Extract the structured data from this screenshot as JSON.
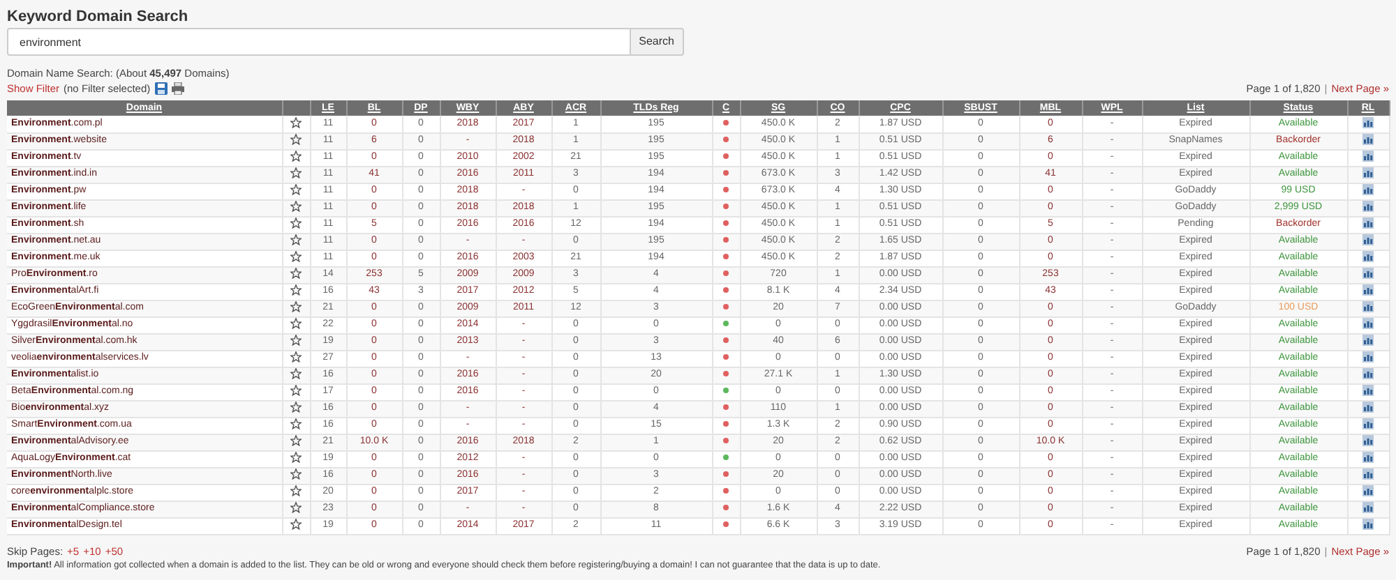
{
  "title": "Keyword Domain Search",
  "search": {
    "value": "environment",
    "button": "Search"
  },
  "summary": "Domain Name Search: (About **45,497** Domains)",
  "filter": {
    "link": "Show Filter",
    "note": "(no Filter selected)"
  },
  "pager_top": {
    "text": "Page 1 of 1,820",
    "separator": "|",
    "link": "Next Page »"
  },
  "table": {
    "columns": [
      "Domain",
      "LE",
      "BL",
      "DP",
      "WBY",
      "ABY",
      "ACR",
      "TLDs Reg",
      "C",
      "SG",
      "CO",
      "CPC",
      "SBUST",
      "MBL",
      "WPL",
      "List",
      "Status",
      "RL"
    ],
    "rows": [
      {
        "domain": "**Environment**.com.pl",
        "le": "11",
        "bl": "0",
        "dp": "0",
        "wby": "2018",
        "aby": "2017",
        "acr": "1",
        "tlds_reg": "195",
        "c": {
          "color": "#e06060"
        },
        "sg": "450.0 K",
        "co": "2",
        "cpc": "1.87 USD",
        "sbust": "0",
        "mbl": "0",
        "wpl": "-",
        "list": "Expired",
        "status": {
          "text": "Available",
          "color": "#3c943c"
        }
      },
      {
        "domain": "**Environment**.website",
        "le": "11",
        "bl": "6",
        "dp": "0",
        "wby": "-",
        "aby": "2018",
        "acr": "1",
        "tlds_reg": "195",
        "c": {
          "color": "#e06060"
        },
        "sg": "450.0 K",
        "co": "1",
        "cpc": "0.51 USD",
        "sbust": "0",
        "mbl": "6",
        "wpl": "-",
        "list": "SnapNames",
        "status": {
          "text": "Backorder",
          "color": "#a0302a"
        }
      },
      {
        "domain": "**Environment**.tv",
        "le": "11",
        "bl": "0",
        "dp": "0",
        "wby": "2010",
        "aby": "2002",
        "acr": "21",
        "tlds_reg": "195",
        "c": {
          "color": "#e06060"
        },
        "sg": "450.0 K",
        "co": "1",
        "cpc": "0.51 USD",
        "sbust": "0",
        "mbl": "0",
        "wpl": "-",
        "list": "Expired",
        "status": {
          "text": "Available",
          "color": "#3c943c"
        }
      },
      {
        "domain": "**Environment**.ind.in",
        "le": "11",
        "bl": "41",
        "dp": "0",
        "wby": "2016",
        "aby": "2011",
        "acr": "3",
        "tlds_reg": "194",
        "c": {
          "color": "#e06060"
        },
        "sg": "673.0 K",
        "co": "3",
        "cpc": "1.42 USD",
        "sbust": "0",
        "mbl": "41",
        "wpl": "-",
        "list": "Expired",
        "status": {
          "text": "Available",
          "color": "#3c943c"
        }
      },
      {
        "domain": "**Environment**.pw",
        "le": "11",
        "bl": "0",
        "dp": "0",
        "wby": "2018",
        "aby": "-",
        "acr": "0",
        "tlds_reg": "194",
        "c": {
          "color": "#e06060"
        },
        "sg": "673.0 K",
        "co": "4",
        "cpc": "1.30 USD",
        "sbust": "0",
        "mbl": "0",
        "wpl": "-",
        "list": "GoDaddy",
        "status": {
          "text": "99 USD",
          "color": "#3c943c"
        }
      },
      {
        "domain": "**Environment**.life",
        "le": "11",
        "bl": "0",
        "dp": "0",
        "wby": "2018",
        "aby": "2018",
        "acr": "1",
        "tlds_reg": "195",
        "c": {
          "color": "#e06060"
        },
        "sg": "450.0 K",
        "co": "1",
        "cpc": "0.51 USD",
        "sbust": "0",
        "mbl": "0",
        "wpl": "-",
        "list": "GoDaddy",
        "status": {
          "text": "2,999 USD",
          "color": "#3c943c"
        }
      },
      {
        "domain": "**Environment**.sh",
        "le": "11",
        "bl": "5",
        "dp": "0",
        "wby": "2016",
        "aby": "2016",
        "acr": "12",
        "tlds_reg": "194",
        "c": {
          "color": "#e06060"
        },
        "sg": "450.0 K",
        "co": "1",
        "cpc": "0.51 USD",
        "sbust": "0",
        "mbl": "5",
        "wpl": "-",
        "list": "Pending",
        "status": {
          "text": "Backorder",
          "color": "#a0302a"
        }
      },
      {
        "domain": "**Environment**.net.au",
        "le": "11",
        "bl": "0",
        "dp": "0",
        "wby": "-",
        "aby": "-",
        "acr": "0",
        "tlds_reg": "195",
        "c": {
          "color": "#e06060"
        },
        "sg": "450.0 K",
        "co": "2",
        "cpc": "1.65 USD",
        "sbust": "0",
        "mbl": "0",
        "wpl": "-",
        "list": "Expired",
        "status": {
          "text": "Available",
          "color": "#3c943c"
        }
      },
      {
        "domain": "**Environment**.me.uk",
        "le": "11",
        "bl": "0",
        "dp": "0",
        "wby": "2016",
        "aby": "2003",
        "acr": "21",
        "tlds_reg": "194",
        "c": {
          "color": "#e06060"
        },
        "sg": "450.0 K",
        "co": "2",
        "cpc": "1.87 USD",
        "sbust": "0",
        "mbl": "0",
        "wpl": "-",
        "list": "Expired",
        "status": {
          "text": "Available",
          "color": "#3c943c"
        }
      },
      {
        "domain": "Pro**Environment**.ro",
        "le": "14",
        "bl": "253",
        "dp": "5",
        "wby": "2009",
        "aby": "2009",
        "acr": "3",
        "tlds_reg": "4",
        "c": {
          "color": "#e06060"
        },
        "sg": "720",
        "co": "1",
        "cpc": "0.00 USD",
        "sbust": "0",
        "mbl": "253",
        "wpl": "-",
        "list": "Expired",
        "status": {
          "text": "Available",
          "color": "#3c943c"
        }
      },
      {
        "domain": "**Environment**alArt.fi",
        "le": "16",
        "bl": "43",
        "dp": "3",
        "wby": "2017",
        "aby": "2012",
        "acr": "5",
        "tlds_reg": "4",
        "c": {
          "color": "#e06060"
        },
        "sg": "8.1 K",
        "co": "4",
        "cpc": "2.34 USD",
        "sbust": "0",
        "mbl": "43",
        "wpl": "-",
        "list": "Expired",
        "status": {
          "text": "Available",
          "color": "#3c943c"
        }
      },
      {
        "domain": "EcoGreen**Environment**al.com",
        "le": "21",
        "bl": "0",
        "dp": "0",
        "wby": "2009",
        "aby": "2011",
        "acr": "12",
        "tlds_reg": "3",
        "c": {
          "color": "#e06060"
        },
        "sg": "20",
        "co": "7",
        "cpc": "0.00 USD",
        "sbust": "0",
        "mbl": "0",
        "wpl": "-",
        "list": "GoDaddy",
        "status": {
          "text": "100 USD",
          "color": "#e89a5a"
        }
      },
      {
        "domain": "Yggdrasil**Environment**al.no",
        "le": "22",
        "bl": "0",
        "dp": "0",
        "wby": "2014",
        "aby": "-",
        "acr": "0",
        "tlds_reg": "0",
        "c": {
          "color": "#5cb85c"
        },
        "sg": "0",
        "co": "0",
        "cpc": "0.00 USD",
        "sbust": "0",
        "mbl": "0",
        "wpl": "-",
        "list": "Expired",
        "status": {
          "text": "Available",
          "color": "#3c943c"
        }
      },
      {
        "domain": "Silver**Environment**al.com.hk",
        "le": "19",
        "bl": "0",
        "dp": "0",
        "wby": "2013",
        "aby": "-",
        "acr": "0",
        "tlds_reg": "3",
        "c": {
          "color": "#e06060"
        },
        "sg": "40",
        "co": "6",
        "cpc": "0.00 USD",
        "sbust": "0",
        "mbl": "0",
        "wpl": "-",
        "list": "Expired",
        "status": {
          "text": "Available",
          "color": "#3c943c"
        }
      },
      {
        "domain": "veolia**environment**alservices.lv",
        "le": "27",
        "bl": "0",
        "dp": "0",
        "wby": "-",
        "aby": "-",
        "acr": "0",
        "tlds_reg": "13",
        "c": {
          "color": "#e06060"
        },
        "sg": "0",
        "co": "0",
        "cpc": "0.00 USD",
        "sbust": "0",
        "mbl": "0",
        "wpl": "-",
        "list": "Expired",
        "status": {
          "text": "Available",
          "color": "#3c943c"
        }
      },
      {
        "domain": "**Environment**alist.io",
        "le": "16",
        "bl": "0",
        "dp": "0",
        "wby": "2016",
        "aby": "-",
        "acr": "0",
        "tlds_reg": "20",
        "c": {
          "color": "#e06060"
        },
        "sg": "27.1 K",
        "co": "1",
        "cpc": "1.30 USD",
        "sbust": "0",
        "mbl": "0",
        "wpl": "-",
        "list": "Expired",
        "status": {
          "text": "Available",
          "color": "#3c943c"
        }
      },
      {
        "domain": "Beta**Environment**al.com.ng",
        "le": "17",
        "bl": "0",
        "dp": "0",
        "wby": "2016",
        "aby": "-",
        "acr": "0",
        "tlds_reg": "0",
        "c": {
          "color": "#5cb85c"
        },
        "sg": "0",
        "co": "0",
        "cpc": "0.00 USD",
        "sbust": "0",
        "mbl": "0",
        "wpl": "-",
        "list": "Expired",
        "status": {
          "text": "Available",
          "color": "#3c943c"
        }
      },
      {
        "domain": "Bio**environment**al.xyz",
        "le": "16",
        "bl": "0",
        "dp": "0",
        "wby": "-",
        "aby": "-",
        "acr": "0",
        "tlds_reg": "4",
        "c": {
          "color": "#e06060"
        },
        "sg": "110",
        "co": "1",
        "cpc": "0.00 USD",
        "sbust": "0",
        "mbl": "0",
        "wpl": "-",
        "list": "Expired",
        "status": {
          "text": "Available",
          "color": "#3c943c"
        }
      },
      {
        "domain": "Smart**Environment**.com.ua",
        "le": "16",
        "bl": "0",
        "dp": "0",
        "wby": "-",
        "aby": "-",
        "acr": "0",
        "tlds_reg": "15",
        "c": {
          "color": "#e06060"
        },
        "sg": "1.3 K",
        "co": "2",
        "cpc": "0.90 USD",
        "sbust": "0",
        "mbl": "0",
        "wpl": "-",
        "list": "Expired",
        "status": {
          "text": "Available",
          "color": "#3c943c"
        }
      },
      {
        "domain": "**Environment**alAdvisory.ee",
        "le": "21",
        "bl": "10.0 K",
        "dp": "0",
        "wby": "2016",
        "aby": "2018",
        "acr": "2",
        "tlds_reg": "1",
        "c": {
          "color": "#e06060"
        },
        "sg": "20",
        "co": "2",
        "cpc": "0.62 USD",
        "sbust": "0",
        "mbl": "10.0 K",
        "wpl": "-",
        "list": "Expired",
        "status": {
          "text": "Available",
          "color": "#3c943c"
        }
      },
      {
        "domain": "AquaLogy**Environment**.cat",
        "le": "19",
        "bl": "0",
        "dp": "0",
        "wby": "2012",
        "aby": "-",
        "acr": "0",
        "tlds_reg": "0",
        "c": {
          "color": "#5cb85c"
        },
        "sg": "0",
        "co": "0",
        "cpc": "0.00 USD",
        "sbust": "0",
        "mbl": "0",
        "wpl": "-",
        "list": "Expired",
        "status": {
          "text": "Available",
          "color": "#3c943c"
        }
      },
      {
        "domain": "**Environment**North.live",
        "le": "16",
        "bl": "0",
        "dp": "0",
        "wby": "2016",
        "aby": "-",
        "acr": "0",
        "tlds_reg": "3",
        "c": {
          "color": "#e06060"
        },
        "sg": "20",
        "co": "0",
        "cpc": "0.00 USD",
        "sbust": "0",
        "mbl": "0",
        "wpl": "-",
        "list": "Expired",
        "status": {
          "text": "Available",
          "color": "#3c943c"
        }
      },
      {
        "domain": "core**environment**alplc.store",
        "le": "20",
        "bl": "0",
        "dp": "0",
        "wby": "2017",
        "aby": "-",
        "acr": "0",
        "tlds_reg": "2",
        "c": {
          "color": "#e06060"
        },
        "sg": "0",
        "co": "0",
        "cpc": "0.00 USD",
        "sbust": "0",
        "mbl": "0",
        "wpl": "-",
        "list": "Expired",
        "status": {
          "text": "Available",
          "color": "#3c943c"
        }
      },
      {
        "domain": "**Environment**alCompliance.store",
        "le": "23",
        "bl": "0",
        "dp": "0",
        "wby": "-",
        "aby": "-",
        "acr": "0",
        "tlds_reg": "8",
        "c": {
          "color": "#e06060"
        },
        "sg": "1.6 K",
        "co": "4",
        "cpc": "2.22 USD",
        "sbust": "0",
        "mbl": "0",
        "wpl": "-",
        "list": "Expired",
        "status": {
          "text": "Available",
          "color": "#3c943c"
        }
      },
      {
        "domain": "**Environment**alDesign.tel",
        "le": "19",
        "bl": "0",
        "dp": "0",
        "wby": "2014",
        "aby": "2017",
        "acr": "2",
        "tlds_reg": "11",
        "c": {
          "color": "#e06060"
        },
        "sg": "6.6 K",
        "co": "3",
        "cpc": "3.19 USD",
        "sbust": "0",
        "mbl": "0",
        "wpl": "-",
        "list": "Expired",
        "status": {
          "text": "Available",
          "color": "#3c943c"
        }
      }
    ]
  },
  "skip": {
    "label": "Skip Pages:",
    "links": [
      "+5",
      "+10",
      "+50"
    ]
  },
  "pager_bottom": {
    "text": "Page 1 of 1,820",
    "separator": "|",
    "link": "Next Page »"
  },
  "notice": "**Important!** All information got collected when a domain is added to the list. They can be old or wrong and everyone should check them before registering/buying a domain! I can not guarantee that the data is up to date."
}
